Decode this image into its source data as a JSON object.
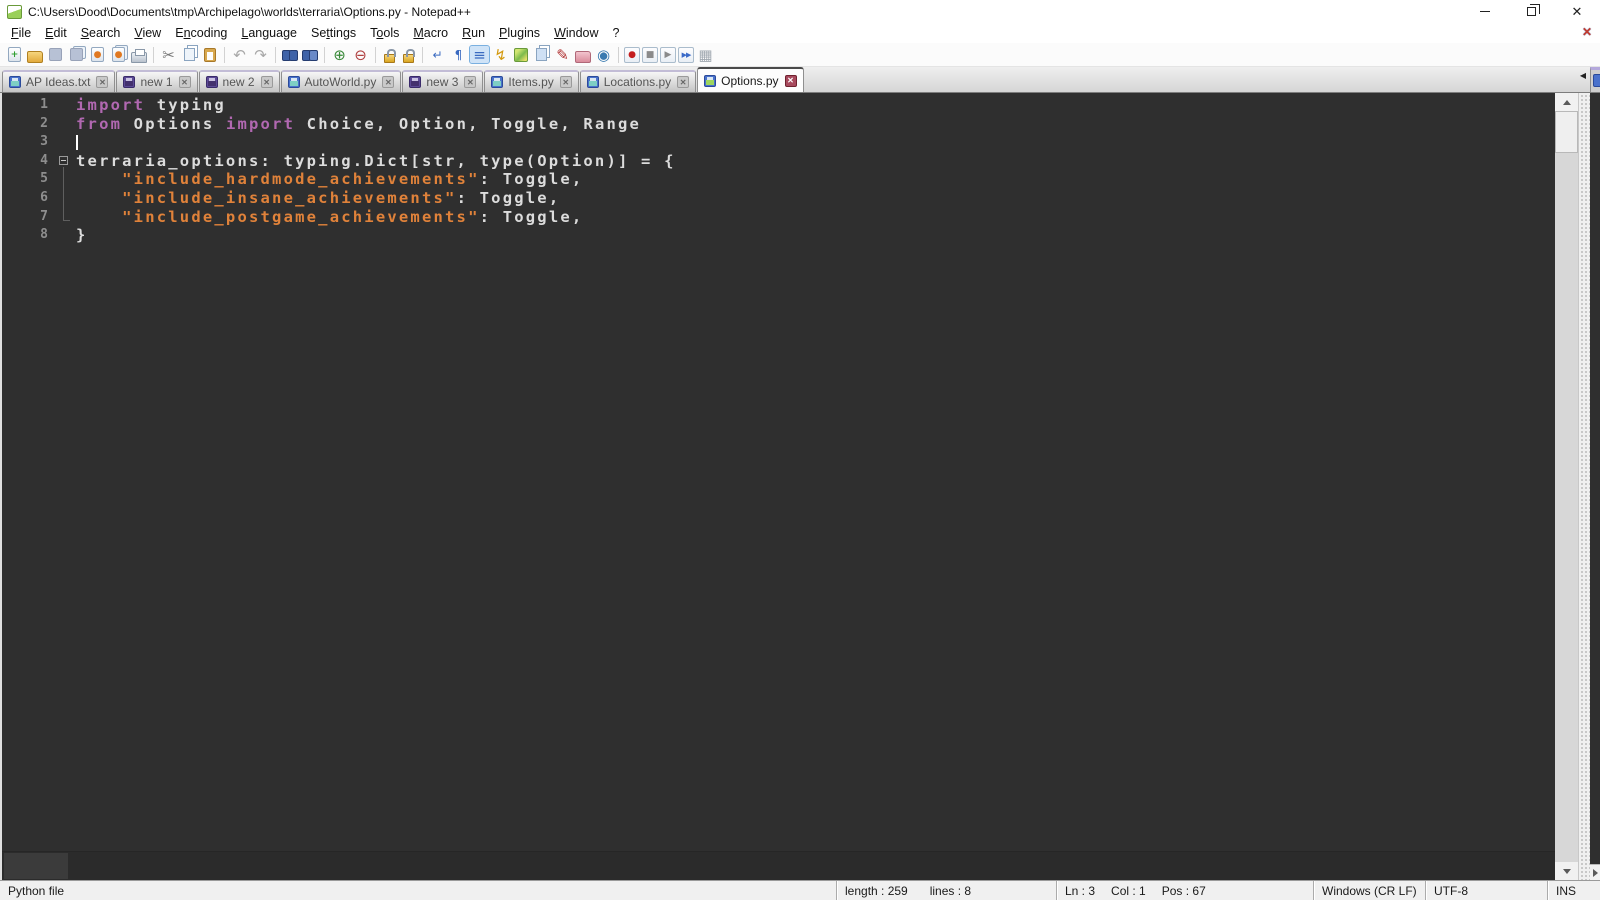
{
  "window": {
    "title": "C:\\Users\\Dood\\Documents\\tmp\\Archipelago\\worlds\\terraria\\Options.py - Notepad++",
    "close_glyph": "✕"
  },
  "menu": {
    "items": [
      {
        "label": "File",
        "accel": 0
      },
      {
        "label": "Edit",
        "accel": 0
      },
      {
        "label": "Search",
        "accel": 0
      },
      {
        "label": "View",
        "accel": 0
      },
      {
        "label": "Encoding",
        "accel": 1
      },
      {
        "label": "Language",
        "accel": 0
      },
      {
        "label": "Settings",
        "accel": 2
      },
      {
        "label": "Tools",
        "accel": 1
      },
      {
        "label": "Macro",
        "accel": 0
      },
      {
        "label": "Run",
        "accel": 0
      },
      {
        "label": "Plugins",
        "accel": 0
      },
      {
        "label": "Window",
        "accel": 0
      },
      {
        "label": "?",
        "accel": -1
      }
    ],
    "close_doc_glyph": "✕"
  },
  "toolbar": {
    "groups": [
      [
        {
          "name": "new-file-icon",
          "cls": "page",
          "glyph": "+",
          "fg": "#2e9e2e"
        },
        {
          "name": "open-folder-icon",
          "cls": "folder",
          "glyph": ""
        },
        {
          "name": "save-icon",
          "cls": "floppy-dis",
          "glyph": ""
        },
        {
          "name": "save-all-icon",
          "cls": "floppy-dis stack",
          "glyph": ""
        },
        {
          "name": "close-file-icon",
          "cls": "page",
          "glyph": "●",
          "fg": "#e07820"
        },
        {
          "name": "close-all-files-icon",
          "cls": "page stack",
          "glyph": "●",
          "fg": "#e07820"
        },
        {
          "name": "print-icon",
          "cls": "printer",
          "glyph": ""
        }
      ],
      [
        {
          "name": "cut-icon",
          "cls": "big",
          "glyph": "✂",
          "fg": "#787878"
        },
        {
          "name": "copy-icon",
          "cls": "pages",
          "glyph": ""
        },
        {
          "name": "paste-icon",
          "cls": "clipboard",
          "glyph": ""
        }
      ],
      [
        {
          "name": "undo-icon",
          "cls": "big",
          "glyph": "↶",
          "fg": "#a8a8a8"
        },
        {
          "name": "redo-icon",
          "cls": "big",
          "glyph": "↷",
          "fg": "#a8a8a8"
        }
      ],
      [
        {
          "name": "find-icon",
          "cls": "binoc",
          "glyph": ""
        },
        {
          "name": "replace-icon",
          "cls": "binoc b2",
          "glyph": ""
        }
      ],
      [
        {
          "name": "zoom-in-icon",
          "cls": "big",
          "glyph": "⊕",
          "fg": "#3a8a3a"
        },
        {
          "name": "zoom-out-icon",
          "cls": "big",
          "glyph": "⊖",
          "fg": "#b04040"
        }
      ],
      [
        {
          "name": "sync-vertical-scroll-icon",
          "cls": "lock",
          "glyph": ""
        },
        {
          "name": "sync-horizontal-scroll-icon",
          "cls": "lock",
          "glyph": ""
        }
      ],
      [
        {
          "name": "word-wrap-icon",
          "cls": "",
          "glyph": "↵",
          "fg": "#3a6ac0"
        },
        {
          "name": "show-all-characters-icon",
          "cls": "",
          "glyph": "¶",
          "fg": "#3a6ac0"
        },
        {
          "name": "show-indent-guide-icon",
          "cls": "active big",
          "glyph": "≡",
          "fg": "#3a6ac0"
        },
        {
          "name": "function-list-icon",
          "cls": "big",
          "glyph": "↯",
          "fg": "#d49a10"
        },
        {
          "name": "document-map-icon",
          "cls": "map",
          "glyph": ""
        },
        {
          "name": "document-list-icon",
          "cls": "pages blue",
          "glyph": ""
        },
        {
          "name": "define-language-icon",
          "cls": "big",
          "glyph": "✎",
          "fg": "#b03030"
        },
        {
          "name": "folder-as-workspace-icon",
          "cls": "folder pink",
          "glyph": ""
        },
        {
          "name": "monitoring-eye-icon",
          "cls": "big",
          "glyph": "◉",
          "fg": "#3a7ab0"
        }
      ],
      [
        {
          "name": "macro-record-icon",
          "cls": "boxed",
          "glyph": "●",
          "fg": "#c41e1e"
        },
        {
          "name": "macro-stop-icon",
          "cls": "boxed",
          "glyph": "■",
          "fg": "#8a8a8a"
        },
        {
          "name": "macro-play-icon",
          "cls": "boxed",
          "glyph": "▶",
          "fg": "#8a8a8a"
        },
        {
          "name": "macro-run-multiple-icon",
          "cls": "boxed dbl",
          "glyph": "▶▶",
          "fg": "#3a6ac8"
        },
        {
          "name": "macro-save-icon",
          "cls": "big",
          "glyph": "▦",
          "fg": "#a0a8b0"
        }
      ]
    ]
  },
  "tabbar": {
    "tabs": [
      {
        "label": "AP Ideas.txt",
        "state": "saved",
        "active": false
      },
      {
        "label": "new 1",
        "state": "modified",
        "active": false
      },
      {
        "label": "new 2",
        "state": "modified",
        "active": false
      },
      {
        "label": "AutoWorld.py",
        "state": "saved",
        "active": false
      },
      {
        "label": "new 3",
        "state": "modified",
        "active": false
      },
      {
        "label": "Items.py",
        "state": "saved",
        "active": false
      },
      {
        "label": "Locations.py",
        "state": "saved",
        "active": false
      },
      {
        "label": "Options.py",
        "state": "saved",
        "active": true
      }
    ],
    "close_glyph": "✕",
    "scroll_left_glyph": "◀"
  },
  "editor": {
    "caret": {
      "line": 3,
      "col": 1
    },
    "lines": [
      {
        "num": "1",
        "fold": "",
        "tokens": [
          [
            "k",
            "import"
          ],
          [
            "d",
            " typing"
          ]
        ]
      },
      {
        "num": "2",
        "fold": "",
        "tokens": [
          [
            "k",
            "from"
          ],
          [
            "d",
            " Options "
          ],
          [
            "k",
            "import"
          ],
          [
            "d",
            " Choice, Option, Toggle, Range"
          ]
        ]
      },
      {
        "num": "3",
        "fold": "",
        "tokens": []
      },
      {
        "num": "4",
        "fold": "open",
        "tokens": [
          [
            "d",
            "terraria_options: typing.Dict[str, type(Option)] = {"
          ]
        ]
      },
      {
        "num": "5",
        "fold": "line",
        "tokens": [
          [
            "d",
            "    "
          ],
          [
            "s",
            "\"include_hardmode_achievements\""
          ],
          [
            "d",
            ": Toggle,"
          ]
        ]
      },
      {
        "num": "6",
        "fold": "line",
        "tokens": [
          [
            "d",
            "    "
          ],
          [
            "s",
            "\"include_insane_achievements\""
          ],
          [
            "d",
            ": Toggle,"
          ]
        ]
      },
      {
        "num": "7",
        "fold": "end",
        "tokens": [
          [
            "d",
            "    "
          ],
          [
            "s",
            "\"include_postgame_achievements\""
          ],
          [
            "d",
            ": Toggle,"
          ]
        ]
      },
      {
        "num": "8",
        "fold": "",
        "tokens": [
          [
            "d",
            "}"
          ]
        ]
      }
    ]
  },
  "status_bar": {
    "doctype": "Python file",
    "length_label": "length : 259",
    "lines_label": "lines : 8",
    "ln_label": "Ln : 3",
    "col_label": "Col : 1",
    "pos_label": "Pos : 67",
    "eol": "Windows (CR LF)",
    "encoding": "UTF-8",
    "insert_mode": "INS"
  },
  "colors": {
    "editor_background": "#2f2f2f",
    "keyword": "#b168b1",
    "default_text": "#dcdcdc",
    "string": "#e0823a",
    "line_number": "#8e8e8e",
    "active_tab_close_bg": "#a84a5e",
    "modified_floppy": "#5c4a96",
    "saved_floppy": "#4a72cc"
  }
}
